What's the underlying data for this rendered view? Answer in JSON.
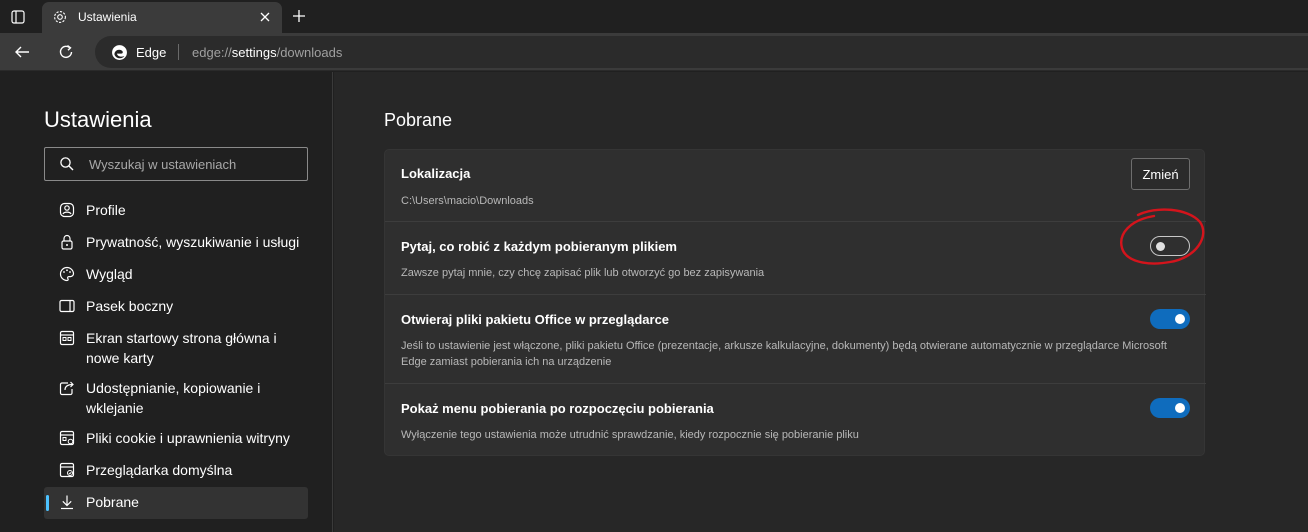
{
  "tab": {
    "title": "Ustawienia"
  },
  "address": {
    "brand": "Edge",
    "url_prefix": "edge://",
    "url_bold": "settings",
    "url_suffix": "/downloads"
  },
  "sidebar": {
    "title": "Ustawienia",
    "search_placeholder": "Wyszukaj w ustawieniach",
    "items": [
      {
        "label": "Profile",
        "icon": "profile-icon"
      },
      {
        "label": "Prywatność, wyszukiwanie i usługi",
        "icon": "lock-icon"
      },
      {
        "label": "Wygląd",
        "icon": "palette-icon"
      },
      {
        "label": "Pasek boczny",
        "icon": "sidebar-icon"
      },
      {
        "label": "Ekran startowy strona główna i nowe karty",
        "icon": "home-icon"
      },
      {
        "label": "Udostępnianie, kopiowanie i wklejanie",
        "icon": "share-icon"
      },
      {
        "label": "Pliki cookie i uprawnienia witryny",
        "icon": "cookie-icon"
      },
      {
        "label": "Przeglądarka domyślna",
        "icon": "browser-icon"
      },
      {
        "label": "Pobrane",
        "icon": "download-icon",
        "active": true
      }
    ]
  },
  "main": {
    "title": "Pobrane",
    "location": {
      "title": "Lokalizacja",
      "path": "C:\\Users\\macio\\Downloads",
      "button": "Zmień"
    },
    "ask": {
      "title": "Pytaj, co robić z każdym pobieranym plikiem",
      "desc": "Zawsze pytaj mnie, czy chcę zapisać plik lub otworzyć go bez zapisywania",
      "enabled": false
    },
    "office": {
      "title": "Otwieraj pliki pakietu Office w przeglądarce",
      "desc": "Jeśli to ustawienie jest włączone, pliki pakietu Office (prezentacje, arkusze kalkulacyjne, dokumenty) będą otwierane automatycznie w przeglądarce Microsoft Edge zamiast pobierania ich na urządzenie",
      "enabled": true
    },
    "menu": {
      "title": "Pokaż menu pobierania po rozpoczęciu pobierania",
      "desc": "Wyłączenie tego ustawienia może utrudnić sprawdzanie, kiedy rozpocznie się pobieranie pliku",
      "enabled": true
    }
  },
  "colors": {
    "accent": "#0f6cbd",
    "annotation": "#d4141c",
    "active_indicator": "#4cc2ff"
  }
}
